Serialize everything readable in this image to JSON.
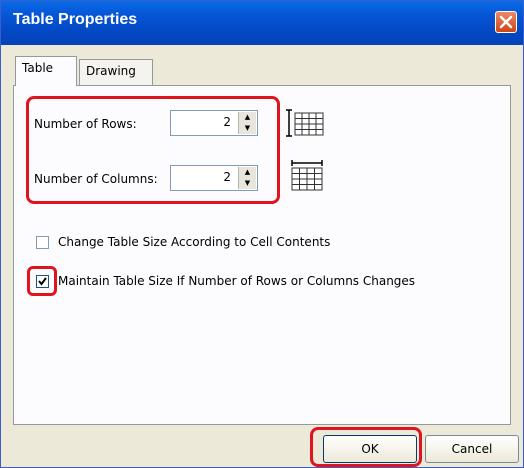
{
  "window": {
    "title": "Table Properties"
  },
  "tabs": [
    {
      "label": "Table",
      "active": true
    },
    {
      "label": "Drawing",
      "active": false
    }
  ],
  "rows": {
    "label": "Number of Rows:",
    "value": "2"
  },
  "columns": {
    "label": "Number of Columns:",
    "value": "2"
  },
  "options": {
    "change_size": {
      "label": "Change Table Size According to Cell Contents",
      "checked": false
    },
    "maintain_size": {
      "label": "Maintain Table Size If Number of Rows or Columns Changes",
      "checked": true
    }
  },
  "buttons": {
    "ok": "OK",
    "cancel": "Cancel"
  },
  "colors": {
    "highlight": "#e0141e",
    "titlebar": "#0656d6",
    "dialog_bg": "#ece9d8"
  }
}
